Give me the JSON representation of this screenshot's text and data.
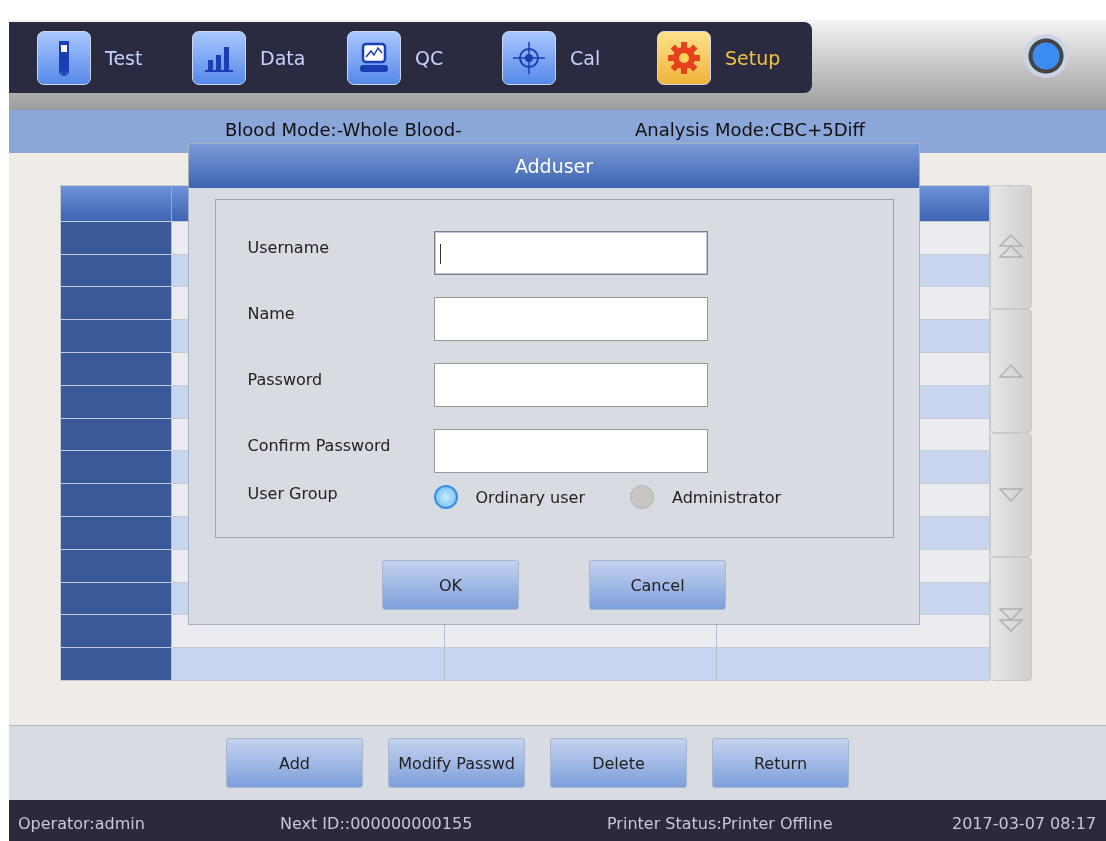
{
  "nav_tabs": [
    {
      "label": "Test",
      "kind": "tube",
      "selected": false
    },
    {
      "label": "Data",
      "kind": "bars",
      "selected": false
    },
    {
      "label": "QC",
      "kind": "monitor",
      "selected": false
    },
    {
      "label": "Cal",
      "kind": "crosshair",
      "selected": false
    },
    {
      "label": "Setup",
      "kind": "gear",
      "selected": true
    }
  ],
  "mode_bar": {
    "blood_mode": "Blood Mode:-Whole Blood-",
    "analysis_mode": "Analysis Mode:CBC+5Diff"
  },
  "dialog": {
    "title": "Adduser",
    "fields": [
      {
        "label": "Username",
        "focused": true
      },
      {
        "label": "Name",
        "focused": false
      },
      {
        "label": "Password",
        "focused": false
      },
      {
        "label": "Confirm Password",
        "focused": false
      }
    ],
    "user_group": {
      "label": "User Group",
      "options": [
        {
          "label": "Ordinary user",
          "selected": true
        },
        {
          "label": "Administrator",
          "selected": false
        }
      ]
    },
    "buttons": [
      "OK",
      "Cancel"
    ]
  },
  "bottom_buttons": [
    "Add",
    "Modify Passwd",
    "Delete",
    "Return"
  ],
  "status_bar": {
    "operator": "Operator:admin",
    "next_id": "Next ID::000000000155",
    "printer_status": "Printer Status:Printer Offline",
    "datetime": "2017-03-07 08:17"
  }
}
